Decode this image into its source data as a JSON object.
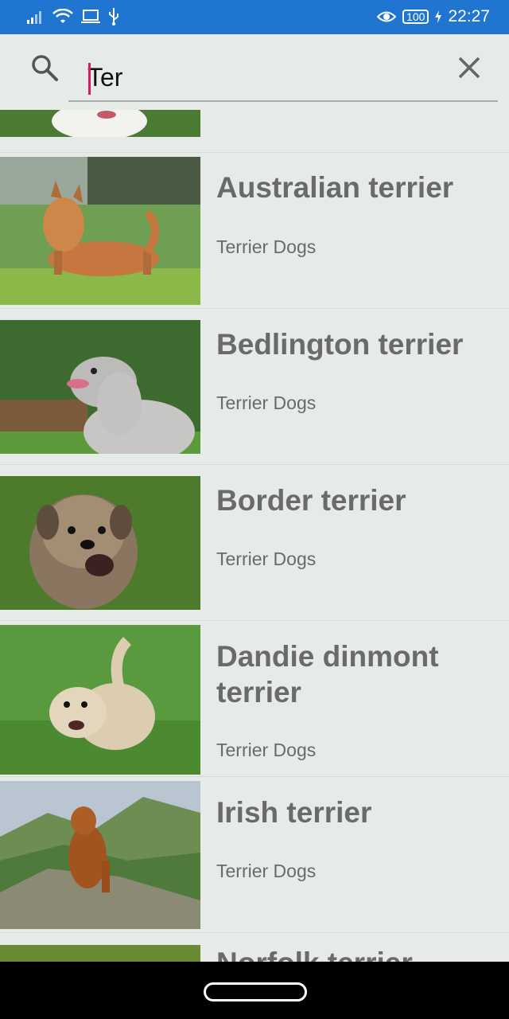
{
  "status_bar": {
    "time": "22:27",
    "battery": "100",
    "colors": {
      "background": "#1f75cf"
    }
  },
  "search": {
    "query": "Ter",
    "caret_color": "#d81b60"
  },
  "results": [
    {
      "title": "Australian terrier",
      "category": "Terrier Dogs"
    },
    {
      "title": "Bedlington terrier",
      "category": "Terrier Dogs"
    },
    {
      "title": "Border terrier",
      "category": "Terrier Dogs"
    },
    {
      "title": "Dandie dinmont terrier",
      "category": "Terrier Dogs"
    },
    {
      "title": "Irish terrier",
      "category": "Terrier Dogs"
    },
    {
      "title": "Norfolk terrier",
      "category": ""
    }
  ]
}
